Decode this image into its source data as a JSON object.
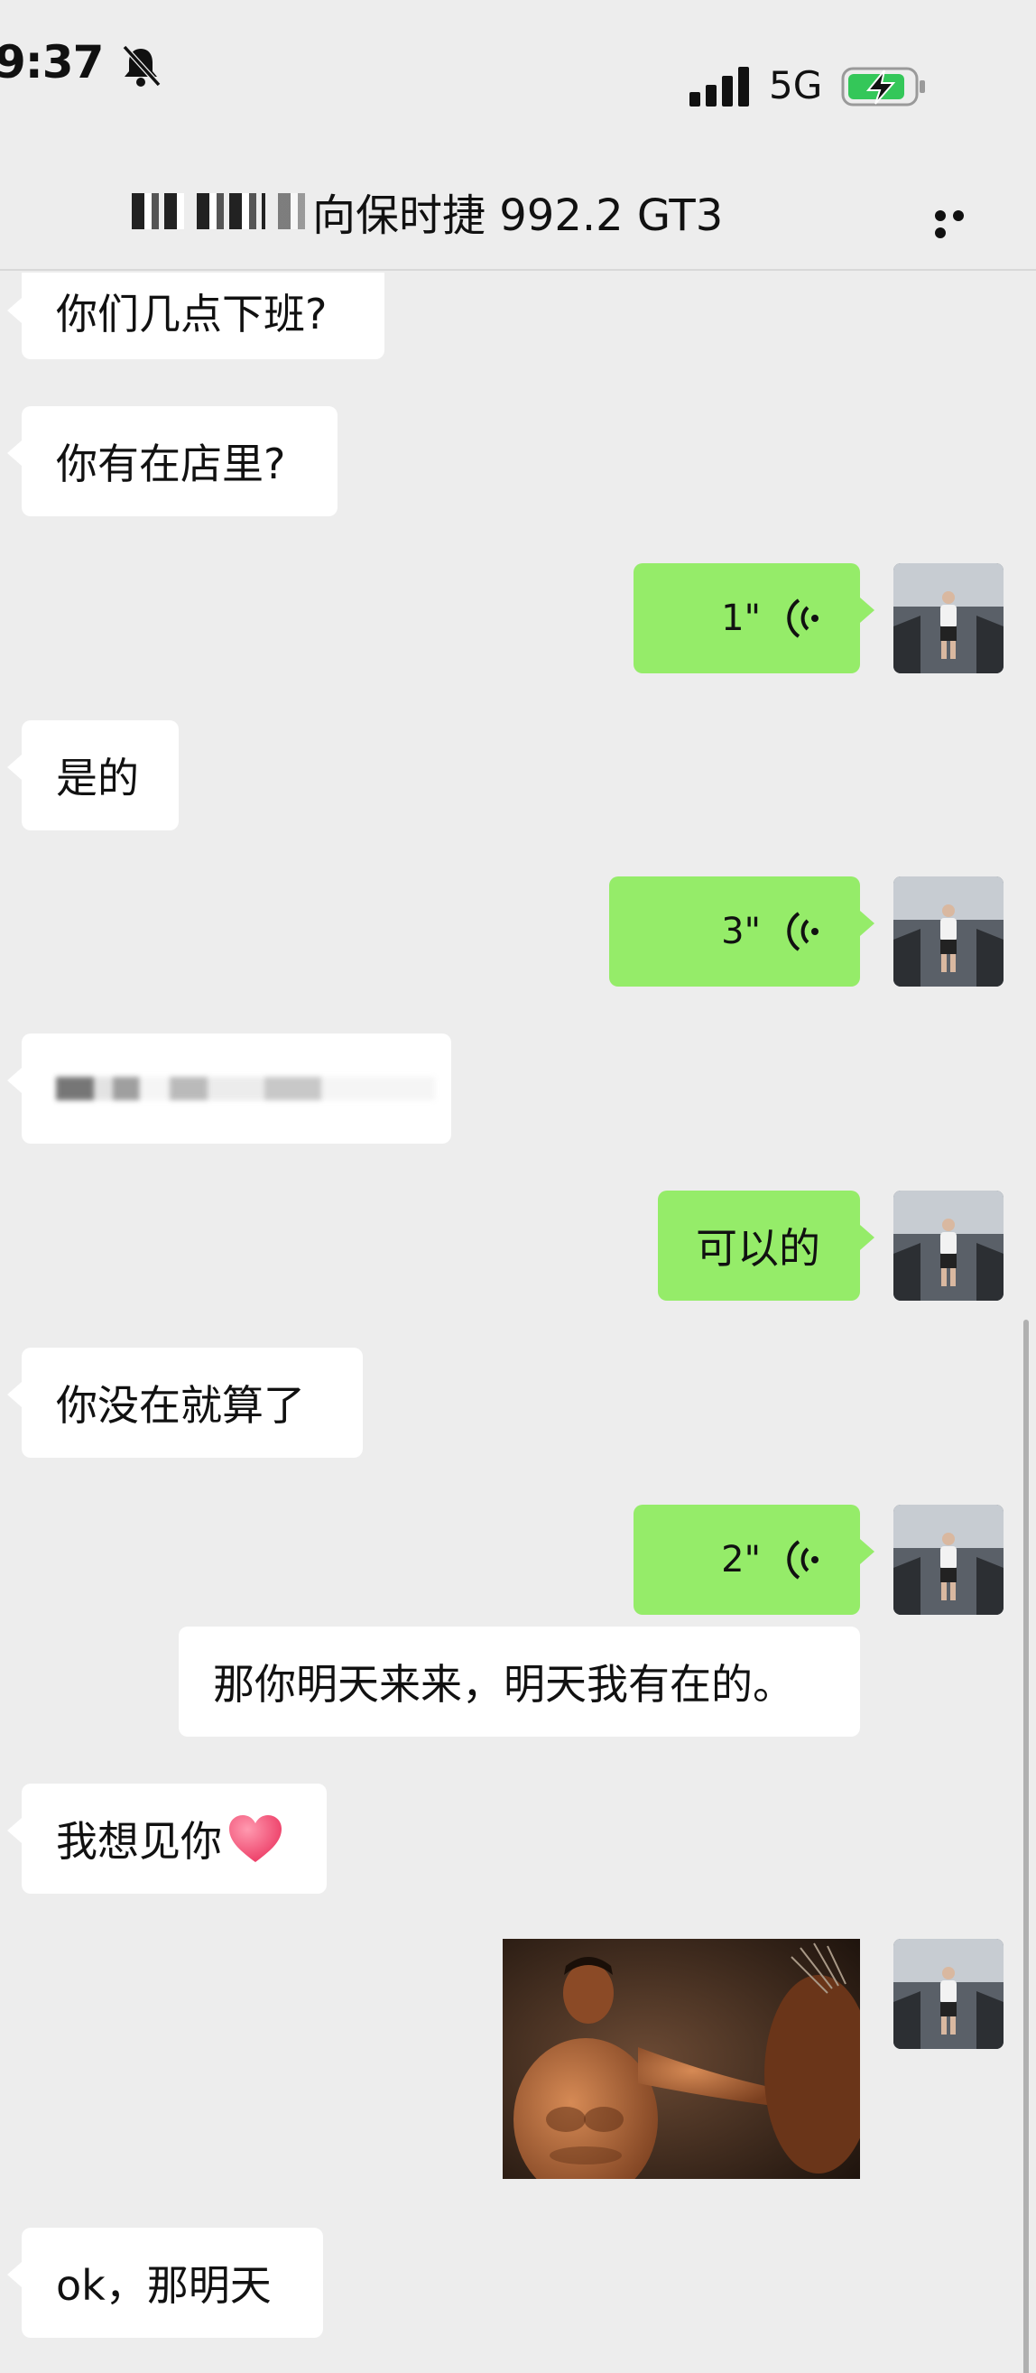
{
  "status_bar": {
    "time": "9:37",
    "network": "5G",
    "icons": [
      "bell-muted-icon",
      "signal-icon",
      "battery-charging-icon"
    ]
  },
  "nav": {
    "title": "向保时捷 992.2 GT3",
    "more_icon": "more-icon"
  },
  "colors": {
    "background": "#ededed",
    "incoming_bubble": "#ffffff",
    "outgoing_bubble": "#95ec69"
  },
  "messages": [
    {
      "side": "in",
      "type": "text",
      "text": "你们几点下班?"
    },
    {
      "side": "in",
      "type": "text",
      "text": "你有在店里?"
    },
    {
      "side": "out",
      "type": "voice",
      "duration": "1\""
    },
    {
      "side": "in",
      "type": "text",
      "text": "是的"
    },
    {
      "side": "out",
      "type": "voice",
      "duration": "3\""
    },
    {
      "side": "in",
      "type": "redacted",
      "text": ""
    },
    {
      "side": "out",
      "type": "text",
      "text": "可以的"
    },
    {
      "side": "in",
      "type": "text",
      "text": "你没在就算了"
    },
    {
      "side": "out",
      "type": "voice",
      "duration": "2\""
    },
    {
      "side": "out",
      "type": "text",
      "text": "那你明天来来，明天我有在的。"
    },
    {
      "side": "in",
      "type": "text",
      "text": "我想见你",
      "emoji": "heart-icon"
    },
    {
      "side": "out",
      "type": "image",
      "text": ""
    },
    {
      "side": "in",
      "type": "text",
      "text": "ok，那明天"
    }
  ]
}
